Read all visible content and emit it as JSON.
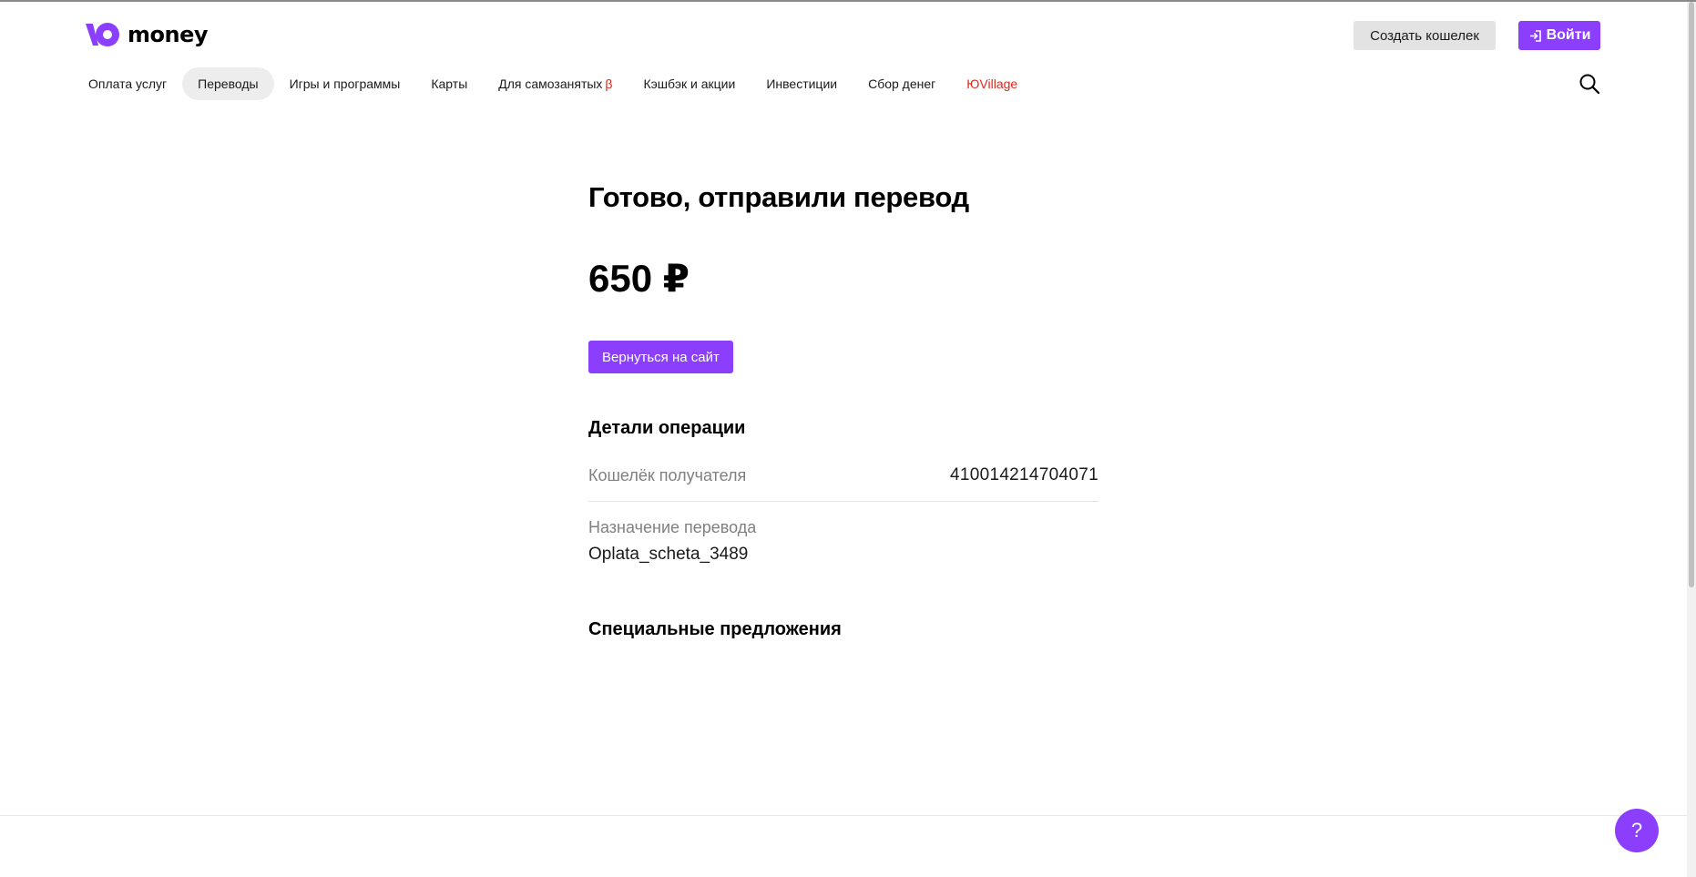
{
  "header": {
    "logo_text": "money",
    "create_wallet_label": "Создать кошелек",
    "login_label": "Войти"
  },
  "nav": {
    "items": [
      {
        "label": "Оплата услуг"
      },
      {
        "label": "Переводы",
        "active": true
      },
      {
        "label": "Игры и программы"
      },
      {
        "label": "Карты"
      },
      {
        "label": "Для самозанятых",
        "badge": "β"
      },
      {
        "label": "Кэшбэк и акции"
      },
      {
        "label": "Инвестиции"
      },
      {
        "label": "Сбор денег"
      },
      {
        "label": "ЮVillage",
        "highlight": true
      }
    ]
  },
  "main": {
    "title": "Готово, отправили перевод",
    "amount": "650 ₽",
    "back_button_label": "Вернуться на сайт",
    "details_title": "Детали операции",
    "recipient_wallet_label": "Кошелёк получателя",
    "recipient_wallet_value": "410014214704071",
    "purpose_label": "Назначение перевода",
    "purpose_value": "Oplata_scheta_3489",
    "offers_title": "Специальные предложения"
  },
  "help_button_label": "?",
  "colors": {
    "accent": "#8b3ffd",
    "highlight_red": "#e0261b",
    "muted_text": "#808080"
  },
  "icons": {
    "logo": "yoomoney-logo-icon",
    "login": "login-arrow-icon",
    "search": "search-icon"
  }
}
